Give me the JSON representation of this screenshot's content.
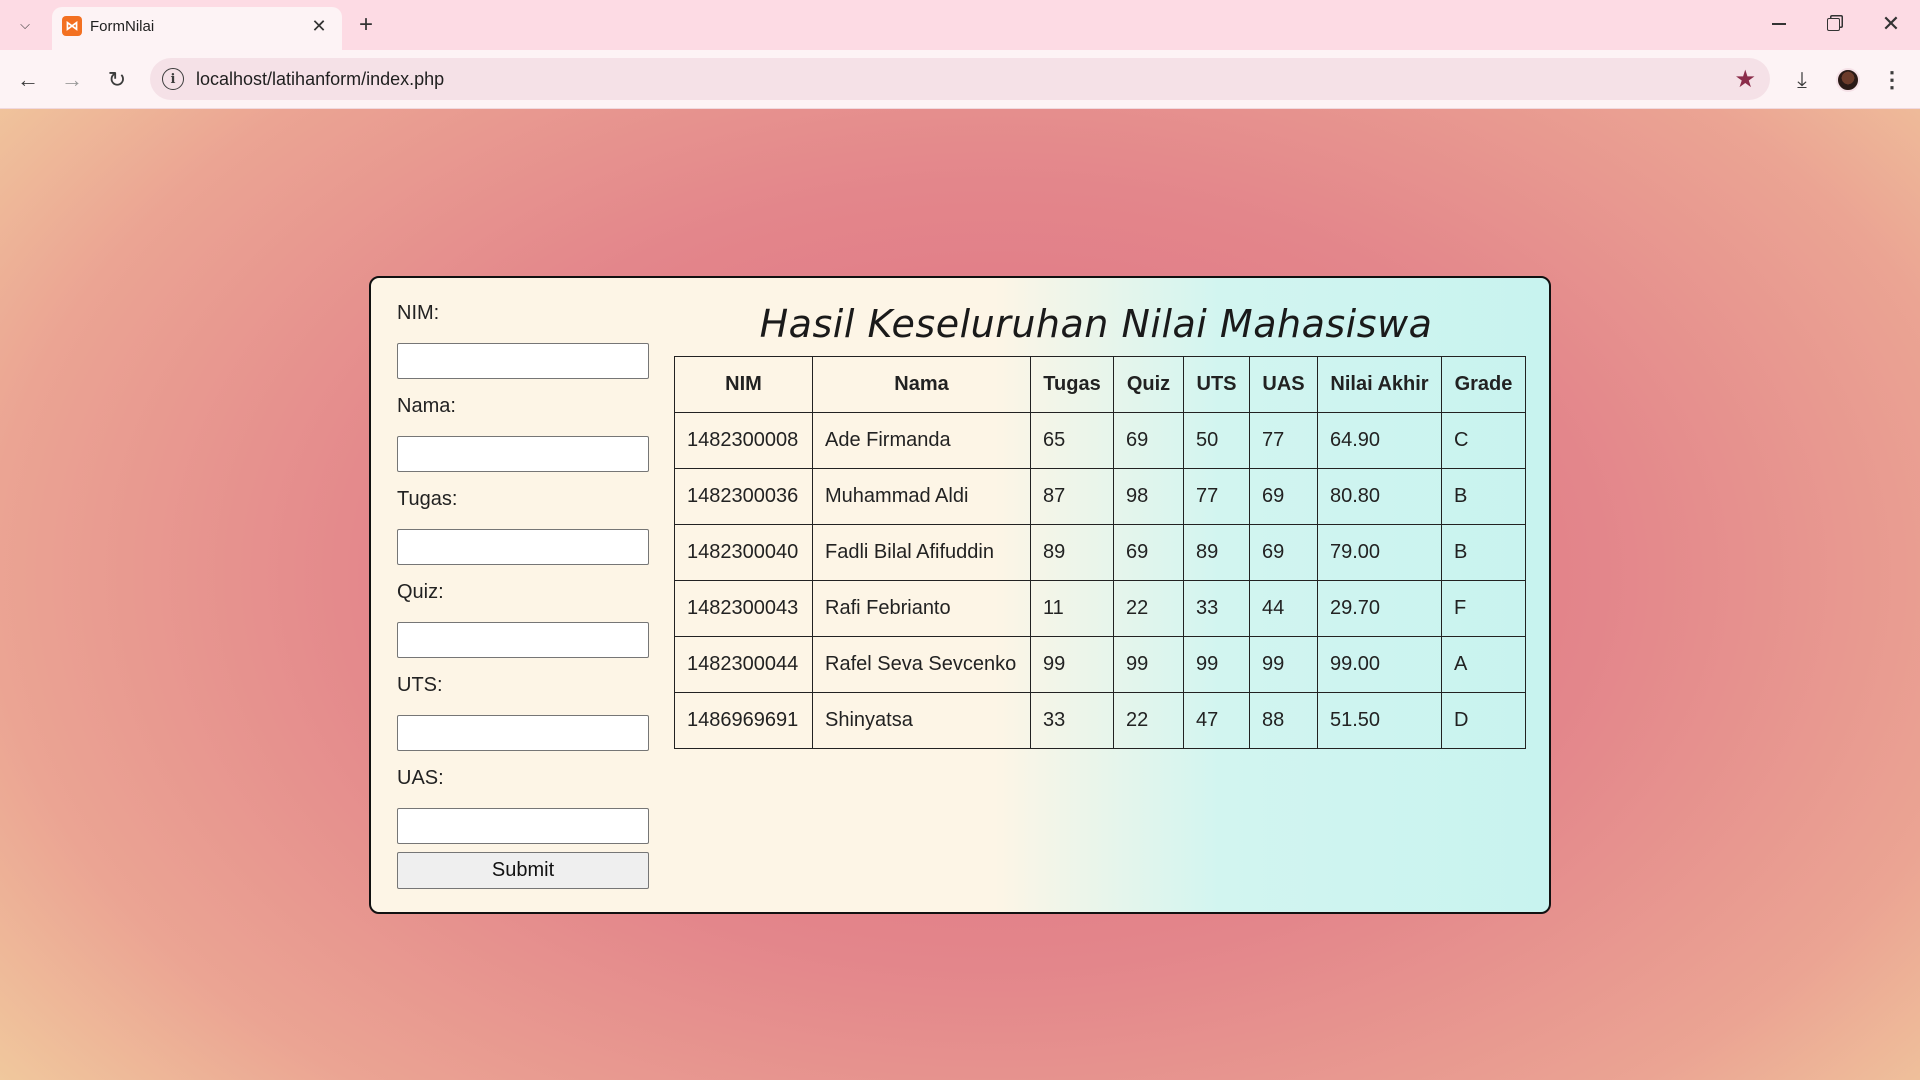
{
  "browser": {
    "tab_title": "FormNilai",
    "url": "localhost/latihanform/index.php"
  },
  "form": {
    "fields": [
      {
        "label": "NIM:",
        "value": ""
      },
      {
        "label": "Nama:",
        "value": ""
      },
      {
        "label": "Tugas:",
        "value": ""
      },
      {
        "label": "Quiz:",
        "value": ""
      },
      {
        "label": "UTS:",
        "value": ""
      },
      {
        "label": "UAS:",
        "value": ""
      }
    ],
    "submit_label": "Submit"
  },
  "results": {
    "title": "Hasil Keseluruhan Nilai Mahasiswa",
    "headers": [
      "NIM",
      "Nama",
      "Tugas",
      "Quiz",
      "UTS",
      "UAS",
      "Nilai Akhir",
      "Grade"
    ],
    "rows": [
      [
        "1482300008",
        "Ade Firmanda",
        "65",
        "69",
        "50",
        "77",
        "64.90",
        "C"
      ],
      [
        "1482300036",
        "Muhammad Aldi",
        "87",
        "98",
        "77",
        "69",
        "80.80",
        "B"
      ],
      [
        "1482300040",
        "Fadli Bilal Afifuddin",
        "89",
        "69",
        "89",
        "69",
        "79.00",
        "B"
      ],
      [
        "1482300043",
        "Rafi Febrianto",
        "11",
        "22",
        "33",
        "44",
        "29.70",
        "F"
      ],
      [
        "1482300044",
        "Rafel Seva Sevcenko",
        "99",
        "99",
        "99",
        "99",
        "99.00",
        "A"
      ],
      [
        "1486969691",
        "Shinyatsa",
        "33",
        "22",
        "47",
        "88",
        "51.50",
        "D"
      ]
    ]
  },
  "colors": {
    "tabbar_bg": "#fddbe4",
    "card_left": "#fdf5e6",
    "card_right": "#c8f3ef",
    "page_center": "#e06c82",
    "page_edge": "#f2d3a0"
  },
  "icons": [
    "tab-list-icon",
    "xampp-favicon-icon",
    "close-icon",
    "plus-icon",
    "minimize-icon",
    "restore-icon",
    "window-close-icon",
    "back-arrow-icon",
    "forward-arrow-icon",
    "reload-icon",
    "site-info-icon",
    "bookmark-star-icon",
    "download-icon",
    "profile-avatar-icon",
    "more-menu-icon"
  ]
}
